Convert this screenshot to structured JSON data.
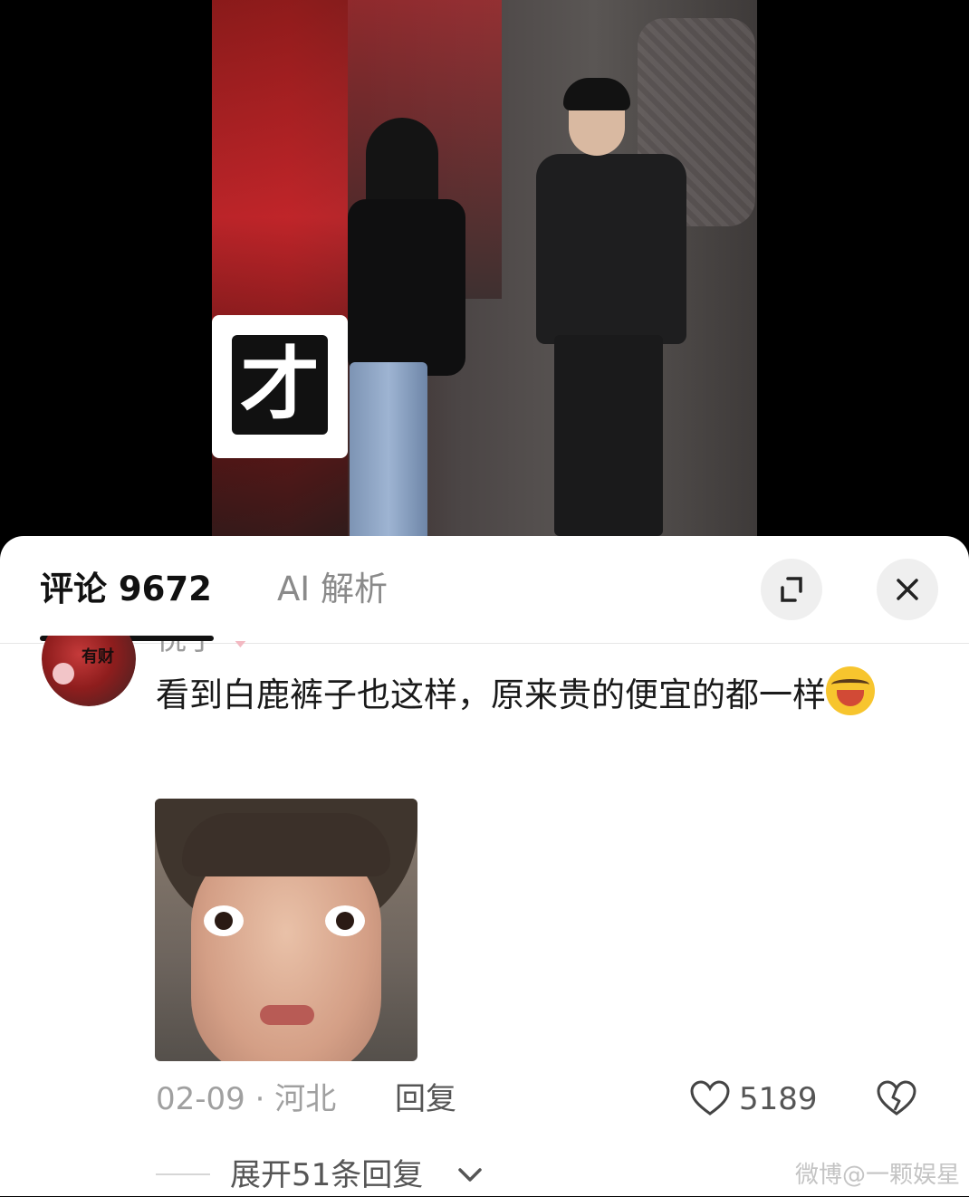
{
  "video": {
    "caption_char": "才"
  },
  "comments_panel": {
    "tab_comments": "评论 9672",
    "tab_ai": "AI 解析",
    "expand_icon": "expand-icon",
    "close_icon": "close-icon"
  },
  "comment": {
    "text": "看到白鹿裤子也这样，原来贵的便宜的都一样",
    "emoji": "laughing-crying-emoji",
    "date_location": "02-09 · 河北",
    "reply_label": "回复",
    "like_count": "5189",
    "expand_replies": "展开51条回复"
  },
  "watermark": "微博@一颗娱星",
  "colors": {
    "sheet_bg": "#ffffff",
    "tab_active": "#111111",
    "tab_inactive": "#8a8a8a",
    "meta_gray": "#a0a0a0"
  }
}
